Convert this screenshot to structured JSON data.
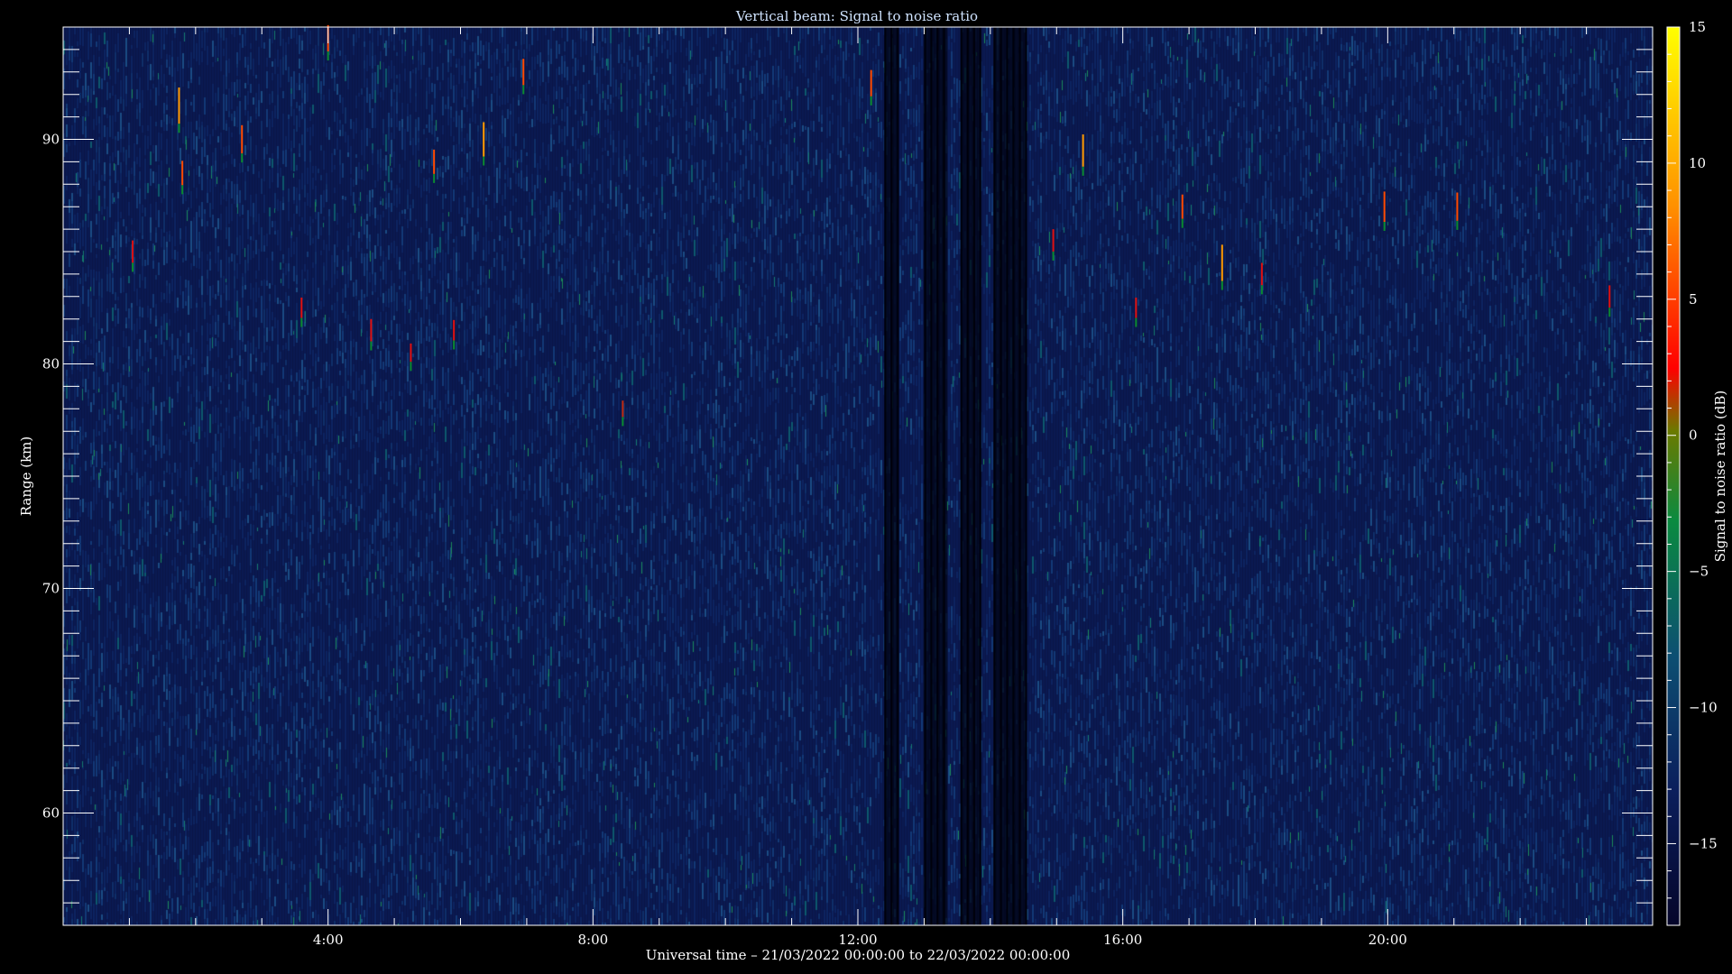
{
  "chart_data": {
    "type": "heatmap",
    "title": "Vertical beam: Signal to noise ratio",
    "xlabel": "Universal time – 21/03/2022 00:00:00 to 22/03/2022 00:00:00",
    "ylabel": "Range (km)",
    "colorbar_label": "Signal to noise ratio (dB)",
    "x_range_hours": [
      0,
      24
    ],
    "x_ticks": [
      {
        "value": 4,
        "label": "4:00"
      },
      {
        "value": 8,
        "label": "8:00"
      },
      {
        "value": 12,
        "label": "12:00"
      },
      {
        "value": 16,
        "label": "16:00"
      },
      {
        "value": 20,
        "label": "20:00"
      }
    ],
    "ylim": [
      55,
      95
    ],
    "y_ticks": [
      {
        "value": 60,
        "label": "60"
      },
      {
        "value": 70,
        "label": "70"
      },
      {
        "value": 80,
        "label": "80"
      },
      {
        "value": 90,
        "label": "90"
      }
    ],
    "y_minor_step": 1,
    "colorbar_range": [
      -18,
      15
    ],
    "colorbar_ticks": [
      {
        "value": 15,
        "label": "15"
      },
      {
        "value": 10,
        "label": "10"
      },
      {
        "value": 5,
        "label": "5"
      },
      {
        "value": 0,
        "label": "0"
      },
      {
        "value": -5,
        "label": "−5"
      },
      {
        "value": -10,
        "label": "−10"
      },
      {
        "value": -15,
        "label": "−15"
      }
    ],
    "colormap": [
      "#0a0a3a",
      "#0c2a70",
      "#0a6a6a",
      "#0a9a20",
      "#c8c000",
      "#ff3000",
      "#ffff00"
    ],
    "background_level_db": -15,
    "data_gaps_hours": [
      12.4,
      12.6,
      13.0,
      13.35,
      13.55,
      13.85,
      14.05,
      14.55
    ],
    "strong_echoes": [
      {
        "time_h": 1.05,
        "range_km": 85.0,
        "snr_db": 2
      },
      {
        "time_h": 1.75,
        "range_km": 91.5,
        "snr_db": 9
      },
      {
        "time_h": 1.8,
        "range_km": 88.5,
        "snr_db": 3
      },
      {
        "time_h": 2.7,
        "range_km": 90.0,
        "snr_db": 5
      },
      {
        "time_h": 3.6,
        "range_km": 82.5,
        "snr_db": 1
      },
      {
        "time_h": 4.0,
        "range_km": 94.5,
        "snr_db": 4
      },
      {
        "time_h": 4.65,
        "range_km": 81.5,
        "snr_db": 2
      },
      {
        "time_h": 5.25,
        "range_km": 80.5,
        "snr_db": 0
      },
      {
        "time_h": 5.6,
        "range_km": 89.0,
        "snr_db": 3
      },
      {
        "time_h": 5.9,
        "range_km": 81.5,
        "snr_db": 1
      },
      {
        "time_h": 6.35,
        "range_km": 90.0,
        "snr_db": 8
      },
      {
        "time_h": 6.95,
        "range_km": 93.0,
        "snr_db": 4
      },
      {
        "time_h": 8.45,
        "range_km": 78.0,
        "snr_db": -1
      },
      {
        "time_h": 12.2,
        "range_km": 92.5,
        "snr_db": 4
      },
      {
        "time_h": 14.95,
        "range_km": 85.5,
        "snr_db": 2
      },
      {
        "time_h": 15.4,
        "range_km": 89.5,
        "snr_db": 7
      },
      {
        "time_h": 16.2,
        "range_km": 82.5,
        "snr_db": 1
      },
      {
        "time_h": 16.9,
        "range_km": 87.0,
        "snr_db": 3
      },
      {
        "time_h": 17.5,
        "range_km": 84.5,
        "snr_db": 9
      },
      {
        "time_h": 18.1,
        "range_km": 84.0,
        "snr_db": 2
      },
      {
        "time_h": 19.95,
        "range_km": 87.0,
        "snr_db": 6
      },
      {
        "time_h": 21.05,
        "range_km": 87.0,
        "snr_db": 5
      },
      {
        "time_h": 23.35,
        "range_km": 83.0,
        "snr_db": 2
      }
    ]
  }
}
